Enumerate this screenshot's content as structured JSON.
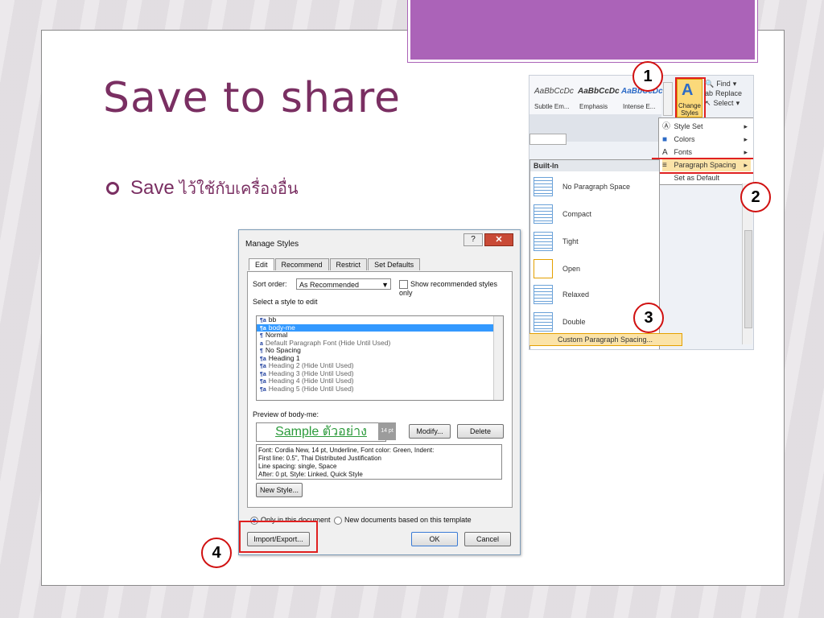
{
  "slide": {
    "title": "Save to share",
    "bullet_label": "Save",
    "bullet_thai": "ไว้ใช้กับเครื่องอื่น"
  },
  "markers": [
    "1",
    "2",
    "3",
    "4"
  ],
  "ribbon": {
    "gallery": [
      {
        "preview": "AaBbCcDc",
        "name": "Subtle Em..."
      },
      {
        "preview": "AaBbCcDc",
        "name": "Emphasis"
      },
      {
        "preview": "AaBbCcDc",
        "name": "Intense E..."
      }
    ],
    "change_styles": "Change Styles",
    "find": "Find",
    "replace": "Replace",
    "select": "Select",
    "styles_menu": [
      {
        "label": "Style Set",
        "icon": "style-set-icon"
      },
      {
        "label": "Colors",
        "icon": "colors-icon"
      },
      {
        "label": "Fonts",
        "icon": "fonts-icon"
      },
      {
        "label": "Paragraph Spacing",
        "icon": "paragraph-spacing-icon"
      },
      {
        "label": "Set as Default",
        "icon": ""
      }
    ],
    "builtin_header": "Built-In",
    "spacing_options": [
      "No Paragraph Space",
      "Compact",
      "Tight",
      "Open",
      "Relaxed",
      "Double"
    ],
    "custom": "Custom Paragraph Spacing..."
  },
  "dialog": {
    "title": "Manage Styles",
    "tabs": [
      "Edit",
      "Recommend",
      "Restrict",
      "Set Defaults"
    ],
    "sort_label": "Sort order:",
    "sort_value": "As Recommended",
    "show_recommended": "Show recommended styles only",
    "select_label": "Select a style to edit",
    "styles": [
      {
        "glyph": "¶a",
        "name": "bb"
      },
      {
        "glyph": "¶a",
        "name": "body-me"
      },
      {
        "glyph": "¶",
        "name": "Normal"
      },
      {
        "glyph": "a",
        "name": "Default Paragraph Font  (Hide Until Used)"
      },
      {
        "glyph": "¶",
        "name": "No Spacing"
      },
      {
        "glyph": "¶a",
        "name": "Heading 1"
      },
      {
        "glyph": "¶a",
        "name": "Heading 2  (Hide Until Used)"
      },
      {
        "glyph": "¶a",
        "name": "Heading 3  (Hide Until Used)"
      },
      {
        "glyph": "¶a",
        "name": "Heading 4  (Hide Until Used)"
      },
      {
        "glyph": "¶a",
        "name": "Heading 5  (Hide Until Used)"
      }
    ],
    "selected_index": 1,
    "preview_label": "Preview of body-me:",
    "preview_text": "Sample ตัวอย่าง",
    "preview_size": "14 pt",
    "modify": "Modify...",
    "delete": "Delete",
    "description": [
      "Font: Cordia New, 14 pt, Underline, Font color: Green, Indent:",
      "  First line:  0.5\", Thai Distributed Justification",
      "  Line spacing:  single, Space",
      "  After:  0 pt, Style: Linked, Quick Style"
    ],
    "new_style": "New Style...",
    "only_in_doc": "Only in this document",
    "new_docs": "New documents based on this template",
    "import_export": "Import/Export...",
    "ok": "OK",
    "cancel": "Cancel"
  },
  "colors": {
    "title": "#7a2f62",
    "tab": "#ab63b8",
    "highlight": "#e02020"
  }
}
